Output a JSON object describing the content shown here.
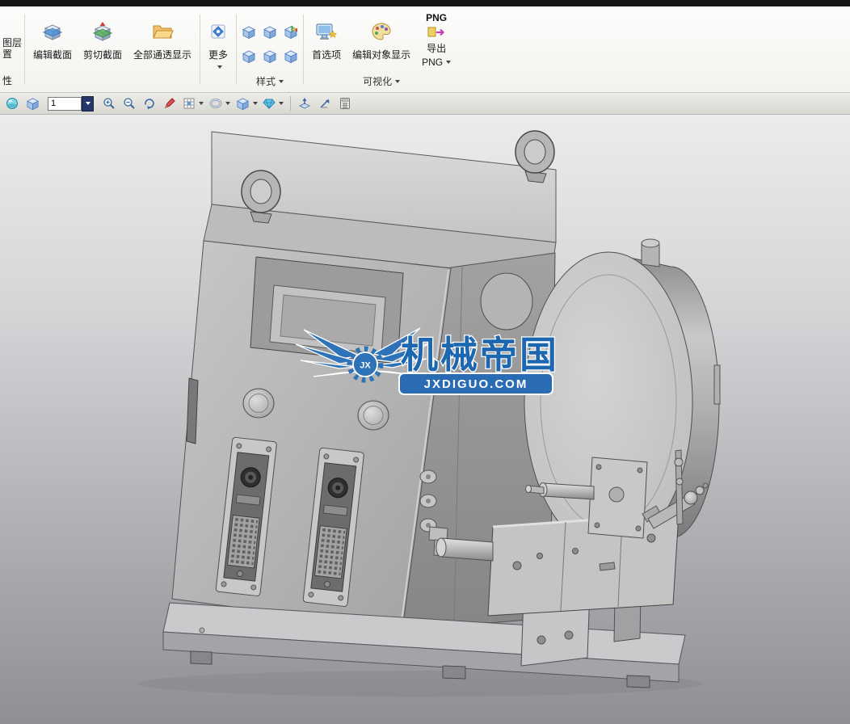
{
  "colors": {
    "brand_blue": "#1d66b0",
    "badge_blue": "#2a6cb4",
    "viewport_top": "#ebeced",
    "viewport_bottom": "#8e9095"
  },
  "ribbon": {
    "clipped": {
      "line1": "图层",
      "line2": "置",
      "bottom": "性"
    },
    "buttons": [
      {
        "name": "edit-section",
        "label": "编辑截面"
      },
      {
        "name": "clip-section",
        "label": "剪切截面"
      },
      {
        "name": "show-all-translucent",
        "label": "全部通透显示"
      },
      {
        "name": "more",
        "label": "更多",
        "dropdown": true
      }
    ],
    "style_group": {
      "label": "样式",
      "dropdown": true,
      "cube_count": 6
    },
    "visualization_group": {
      "label": "可视化",
      "buttons": [
        {
          "name": "preferences",
          "label": "首选项"
        },
        {
          "name": "edit-object-display",
          "label": "编辑对象显示"
        },
        {
          "name": "export-png",
          "icon_text": "PNG",
          "label_line1": "导出",
          "label_line2": "PNG",
          "dropdown": true
        }
      ]
    }
  },
  "toolbar2": {
    "scale_value": "1",
    "icons": [
      "view-sphere",
      "view-cube",
      "scale-combo",
      "zoom-in",
      "zoom-out",
      "rotate-view",
      "sketch-pencil",
      "grid-snap",
      "surface-torus",
      "solid-cube",
      "material-gem",
      "datum-plane",
      "datum-axis",
      "measure-calculator"
    ]
  },
  "watermark": {
    "gear_text": "JX",
    "brand": "机械帝国",
    "domain": "JXDIGUO.COM"
  }
}
